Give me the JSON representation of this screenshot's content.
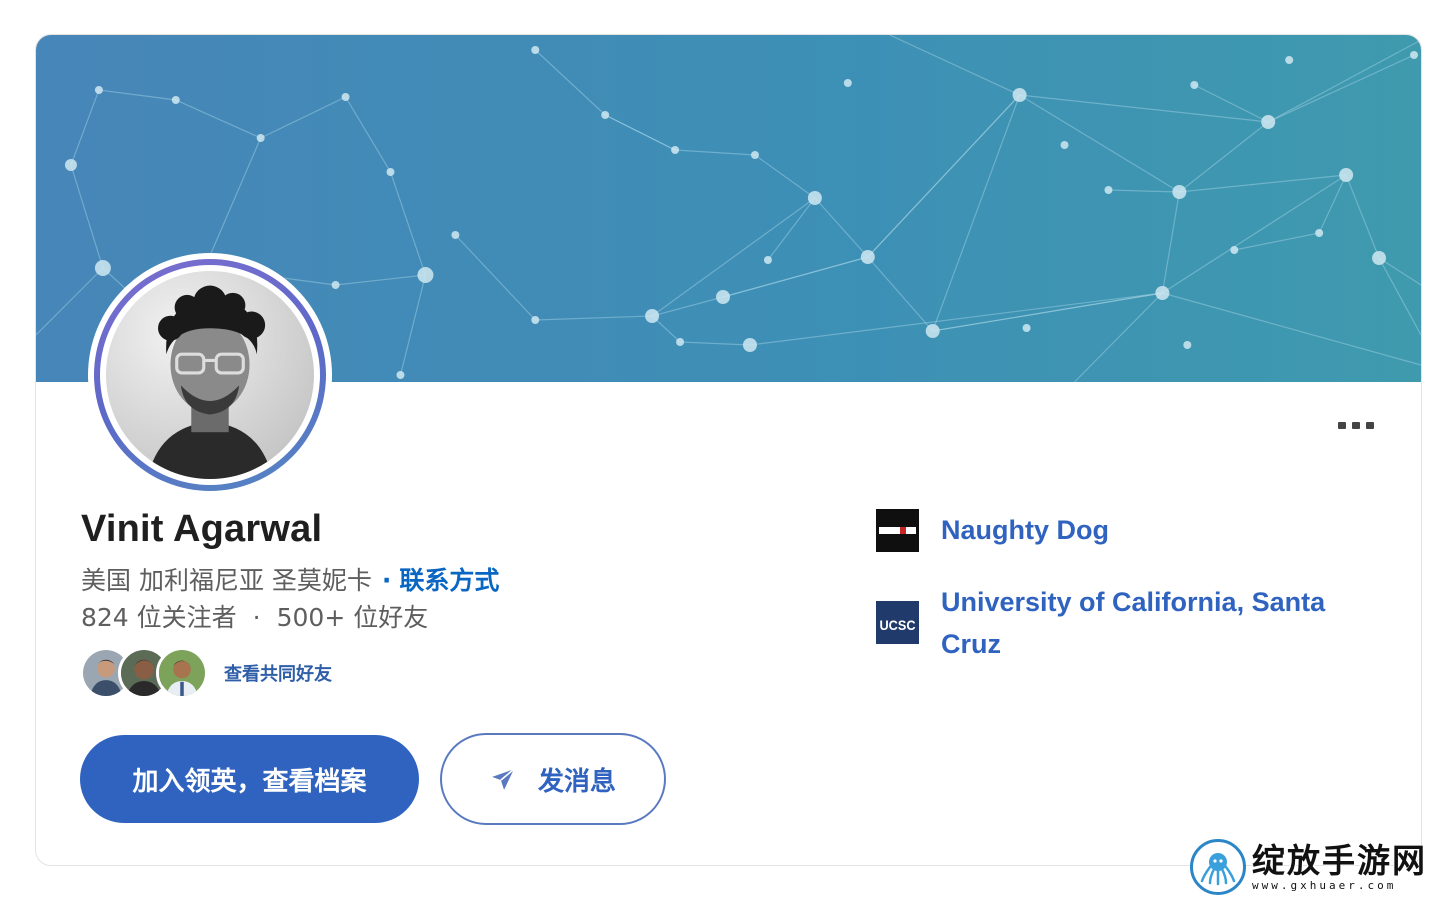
{
  "profile": {
    "name": "Vinit Agarwal",
    "location": "美国 加利福尼亚 圣莫妮卡",
    "location_separator": "·",
    "contact_link": "联系方式",
    "followers": "824 位关注者",
    "stats_separator": "·",
    "connections": "500+ 位好友",
    "mutual_link": "查看共同好友"
  },
  "actions": {
    "join_button": "加入领英，查看档案",
    "message_button": "发消息"
  },
  "organizations": [
    {
      "name": "Naughty Dog",
      "logo_text": "NAUGHTY DOG"
    },
    {
      "name": "University of California, Santa Cruz",
      "logo_text": "UCSC"
    }
  ],
  "watermark": {
    "cn": "绽放手游网",
    "url": "www.gxhuaer.com"
  },
  "colors": {
    "banner_start": "#4786b8",
    "banner_end": "#3f9aae",
    "accent": "#2f63bf",
    "link": "#0a66c2"
  },
  "icons": [
    "more-icon",
    "send-icon",
    "octopus-icon"
  ]
}
